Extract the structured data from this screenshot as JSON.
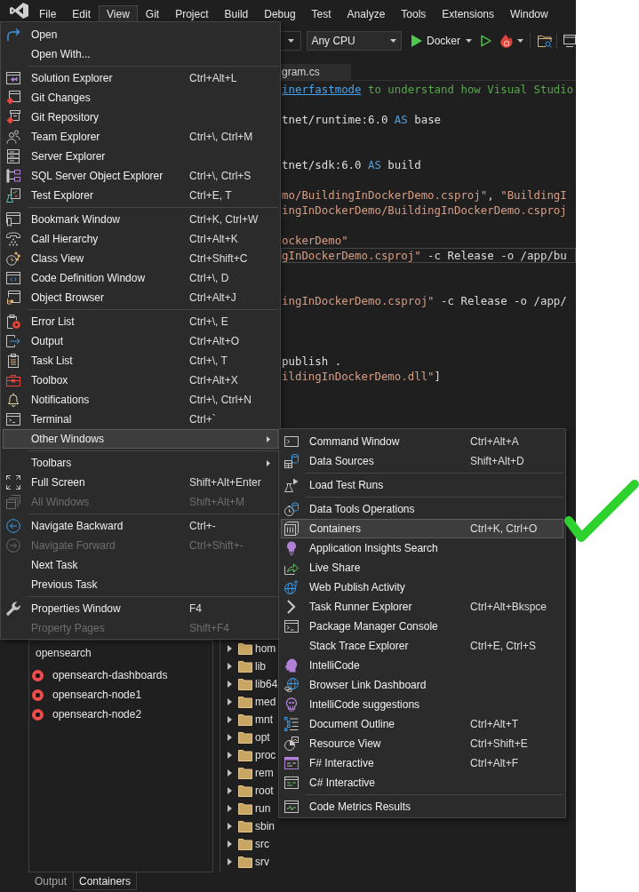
{
  "menu_bar": {
    "items": [
      {
        "label": "File",
        "selected": false
      },
      {
        "label": "Edit",
        "selected": false
      },
      {
        "label": "View",
        "selected": true
      },
      {
        "label": "Git",
        "selected": false
      },
      {
        "label": "Project",
        "selected": false
      },
      {
        "label": "Build",
        "selected": false
      },
      {
        "label": "Debug",
        "selected": false
      },
      {
        "label": "Test",
        "selected": false
      },
      {
        "label": "Analyze",
        "selected": false
      },
      {
        "label": "Tools",
        "selected": false
      },
      {
        "label": "Extensions",
        "selected": false
      },
      {
        "label": "Window",
        "selected": false
      }
    ]
  },
  "toolbar": {
    "platform": "Any CPU",
    "start_target": "Docker"
  },
  "view_menu": {
    "groups": [
      {
        "items": [
          {
            "label": "Open",
            "kind": "command",
            "selected": false,
            "disabled": false
          },
          {
            "label": "Open With...",
            "kind": "command",
            "selected": false,
            "disabled": false
          }
        ]
      },
      {
        "items": [
          {
            "label": "Solution Explorer",
            "shortcut": "Ctrl+Alt+L",
            "kind": "command",
            "selected": false,
            "disabled": false
          },
          {
            "label": "Git Changes",
            "kind": "command",
            "selected": false,
            "disabled": false
          },
          {
            "label": "Git Repository",
            "kind": "command",
            "selected": false,
            "disabled": false
          },
          {
            "label": "Team Explorer",
            "shortcut": "Ctrl+\\, Ctrl+M",
            "kind": "command",
            "selected": false,
            "disabled": false
          },
          {
            "label": "Server Explorer",
            "kind": "command",
            "selected": false,
            "disabled": false
          },
          {
            "label": "SQL Server Object Explorer",
            "shortcut": "Ctrl+\\, Ctrl+S",
            "kind": "command",
            "selected": false,
            "disabled": false
          },
          {
            "label": "Test Explorer",
            "shortcut": "Ctrl+E, T",
            "kind": "command",
            "selected": false,
            "disabled": false
          }
        ]
      },
      {
        "items": [
          {
            "label": "Bookmark Window",
            "shortcut": "Ctrl+K, Ctrl+W",
            "kind": "command",
            "selected": false,
            "disabled": false
          },
          {
            "label": "Call Hierarchy",
            "shortcut": "Ctrl+Alt+K",
            "kind": "command",
            "selected": false,
            "disabled": false
          },
          {
            "label": "Class View",
            "shortcut": "Ctrl+Shift+C",
            "kind": "command",
            "selected": false,
            "disabled": false
          },
          {
            "label": "Code Definition Window",
            "shortcut": "Ctrl+\\, D",
            "kind": "command",
            "selected": false,
            "disabled": false
          },
          {
            "label": "Object Browser",
            "shortcut": "Ctrl+Alt+J",
            "kind": "command",
            "selected": false,
            "disabled": false
          }
        ]
      },
      {
        "items": [
          {
            "label": "Error List",
            "shortcut": "Ctrl+\\, E",
            "kind": "command",
            "selected": false,
            "disabled": false
          },
          {
            "label": "Output",
            "shortcut": "Ctrl+Alt+O",
            "kind": "command",
            "selected": false,
            "disabled": false
          },
          {
            "label": "Task List",
            "shortcut": "Ctrl+\\, T",
            "kind": "command",
            "selected": false,
            "disabled": false
          },
          {
            "label": "Toolbox",
            "shortcut": "Ctrl+Alt+X",
            "kind": "command",
            "selected": false,
            "disabled": false
          },
          {
            "label": "Notifications",
            "shortcut": "Ctrl+\\, Ctrl+N",
            "kind": "command",
            "selected": false,
            "disabled": false
          },
          {
            "label": "Terminal",
            "shortcut": "Ctrl+`",
            "kind": "command",
            "selected": false,
            "disabled": false
          },
          {
            "label": "Other Windows",
            "kind": "submenu",
            "selected": true,
            "disabled": false
          }
        ]
      },
      {
        "items": [
          {
            "label": "Toolbars",
            "kind": "submenu",
            "selected": false,
            "disabled": false
          },
          {
            "label": "Full Screen",
            "shortcut": "Shift+Alt+Enter",
            "kind": "command",
            "selected": false,
            "disabled": false
          },
          {
            "label": "All Windows",
            "shortcut": "Shift+Alt+M",
            "kind": "command",
            "selected": false,
            "disabled": true
          }
        ]
      },
      {
        "items": [
          {
            "label": "Navigate Backward",
            "shortcut": "Ctrl+-",
            "kind": "command",
            "selected": false,
            "disabled": false
          },
          {
            "label": "Navigate Forward",
            "shortcut": "Ctrl+Shift+-",
            "kind": "command",
            "selected": false,
            "disabled": true
          },
          {
            "label": "Next Task",
            "kind": "command",
            "selected": false,
            "disabled": false
          },
          {
            "label": "Previous Task",
            "kind": "command",
            "selected": false,
            "disabled": false
          }
        ]
      },
      {
        "items": [
          {
            "label": "Properties Window",
            "shortcut": "F4",
            "kind": "command",
            "selected": false,
            "disabled": false
          },
          {
            "label": "Property Pages",
            "shortcut": "Shift+F4",
            "kind": "command",
            "selected": false,
            "disabled": true
          }
        ]
      }
    ]
  },
  "editor": {
    "tab": "gram.cs",
    "lines": [
      {
        "kind": "code",
        "current": false,
        "segments": [
          {
            "kind": "link",
            "text": "inerfastmode"
          },
          {
            "kind": "comment",
            "text": " to understand how Visual Studio"
          }
        ]
      },
      {
        "kind": "blank",
        "current": false
      },
      {
        "kind": "code",
        "current": false,
        "segments": [
          {
            "kind": "plain",
            "text": "tnet/runtime:6.0 "
          },
          {
            "kind": "keyword",
            "text": "AS"
          },
          {
            "kind": "plain",
            "text": " base"
          }
        ]
      },
      {
        "kind": "blank",
        "current": false
      },
      {
        "kind": "blank",
        "current": false
      },
      {
        "kind": "code",
        "current": false,
        "segments": [
          {
            "kind": "plain",
            "text": "tnet/sdk:6.0 "
          },
          {
            "kind": "keyword",
            "text": "AS"
          },
          {
            "kind": "plain",
            "text": " build"
          }
        ]
      },
      {
        "kind": "blank",
        "current": false
      },
      {
        "kind": "code",
        "current": false,
        "segments": [
          {
            "kind": "string",
            "text": "mo/BuildingInDockerDemo.csproj\""
          },
          {
            "kind": "plain",
            "text": ", "
          },
          {
            "kind": "string",
            "text": "\"BuildingI"
          }
        ]
      },
      {
        "kind": "code",
        "current": false,
        "segments": [
          {
            "kind": "string",
            "text": "ingInDockerDemo/BuildingInDockerDemo.csproj"
          }
        ]
      },
      {
        "kind": "blank",
        "current": false
      },
      {
        "kind": "code",
        "current": false,
        "segments": [
          {
            "kind": "string",
            "text": "ockerDemo\""
          }
        ]
      },
      {
        "kind": "code",
        "current": true,
        "segments": [
          {
            "kind": "string",
            "text": "gInDockerDemo.csproj\""
          },
          {
            "kind": "plain",
            "text": " -c Release -o /app/bu"
          }
        ]
      },
      {
        "kind": "blank",
        "current": false
      },
      {
        "kind": "blank",
        "current": false
      },
      {
        "kind": "code",
        "current": false,
        "segments": [
          {
            "kind": "string",
            "text": "ingInDockerDemo.csproj\""
          },
          {
            "kind": "plain",
            "text": " -c Release -o /app/"
          }
        ]
      },
      {
        "kind": "blank",
        "current": false
      },
      {
        "kind": "blank",
        "current": false
      },
      {
        "kind": "blank",
        "current": false
      },
      {
        "kind": "code",
        "current": false,
        "segments": [
          {
            "kind": "plain",
            "text": "publish ."
          }
        ]
      },
      {
        "kind": "code",
        "current": false,
        "segments": [
          {
            "kind": "string",
            "text": "ildingInDockerDemo.dll\""
          },
          {
            "kind": "plain",
            "text": "]"
          }
        ]
      }
    ]
  },
  "other_windows_menu": {
    "groups": [
      {
        "items": [
          {
            "label": "Command Window",
            "shortcut": "Ctrl+Alt+A",
            "kind": "command",
            "selected": false,
            "disabled": false
          },
          {
            "label": "Data Sources",
            "shortcut": "Shift+Alt+D",
            "kind": "command",
            "selected": false,
            "disabled": false
          }
        ]
      },
      {
        "items": [
          {
            "label": "Load Test Runs",
            "kind": "command",
            "selected": false,
            "disabled": false
          }
        ]
      },
      {
        "items": [
          {
            "label": "Data Tools Operations",
            "kind": "command",
            "selected": false,
            "disabled": false
          },
          {
            "label": "Containers",
            "shortcut": "Ctrl+K, Ctrl+O",
            "kind": "command",
            "selected": true,
            "disabled": false
          },
          {
            "label": "Application Insights Search",
            "kind": "command",
            "selected": false,
            "disabled": false
          },
          {
            "label": "Live Share",
            "kind": "command",
            "selected": false,
            "disabled": false
          },
          {
            "label": "Web Publish Activity",
            "kind": "command",
            "selected": false,
            "disabled": false
          },
          {
            "label": "Task Runner Explorer",
            "shortcut": "Ctrl+Alt+Bkspce",
            "kind": "command",
            "selected": false,
            "disabled": false
          },
          {
            "label": "Package Manager Console",
            "kind": "command",
            "selected": false,
            "disabled": false
          },
          {
            "label": "Stack Trace Explorer",
            "shortcut": "Ctrl+E, Ctrl+S",
            "kind": "command",
            "selected": false,
            "disabled": false
          },
          {
            "label": "IntelliCode",
            "kind": "command",
            "selected": false,
            "disabled": false
          },
          {
            "label": "Browser Link Dashboard",
            "kind": "command",
            "selected": false,
            "disabled": false
          },
          {
            "label": "IntelliCode suggestions",
            "kind": "command",
            "selected": false,
            "disabled": false
          },
          {
            "label": "Document Outline",
            "shortcut": "Ctrl+Alt+T",
            "kind": "command",
            "selected": false,
            "disabled": false
          },
          {
            "label": "Resource View",
            "shortcut": "Ctrl+Shift+E",
            "kind": "command",
            "selected": false,
            "disabled": false
          },
          {
            "label": "F# Interactive",
            "shortcut": "Ctrl+Alt+F",
            "kind": "command",
            "selected": false,
            "disabled": false
          },
          {
            "label": "C# Interactive",
            "kind": "command",
            "selected": false,
            "disabled": false
          }
        ]
      },
      {
        "items": [
          {
            "label": "Code Metrics Results",
            "kind": "command",
            "selected": false,
            "disabled": false
          }
        ]
      }
    ]
  },
  "containers_panel": {
    "group": "opensearch",
    "containers": [
      {
        "name": "opensearch-dashboards",
        "running": false
      },
      {
        "name": "opensearch-node1",
        "running": false
      },
      {
        "name": "opensearch-node2",
        "running": false
      }
    ],
    "folders": [
      {
        "name": "hom",
        "expanded": false
      },
      {
        "name": "lib",
        "expanded": false
      },
      {
        "name": "lib64",
        "expanded": false
      },
      {
        "name": "med",
        "expanded": false
      },
      {
        "name": "mnt",
        "expanded": false
      },
      {
        "name": "opt",
        "expanded": false
      },
      {
        "name": "proc",
        "expanded": false
      },
      {
        "name": "rem",
        "expanded": false
      },
      {
        "name": "root",
        "expanded": false
      },
      {
        "name": "run",
        "expanded": false
      },
      {
        "name": "sbin",
        "expanded": false
      },
      {
        "name": "src",
        "expanded": false
      },
      {
        "name": "srv",
        "expanded": false
      }
    ]
  },
  "bottom_tabs": [
    {
      "label": "Output",
      "selected": false
    },
    {
      "label": "Containers",
      "selected": true
    }
  ]
}
